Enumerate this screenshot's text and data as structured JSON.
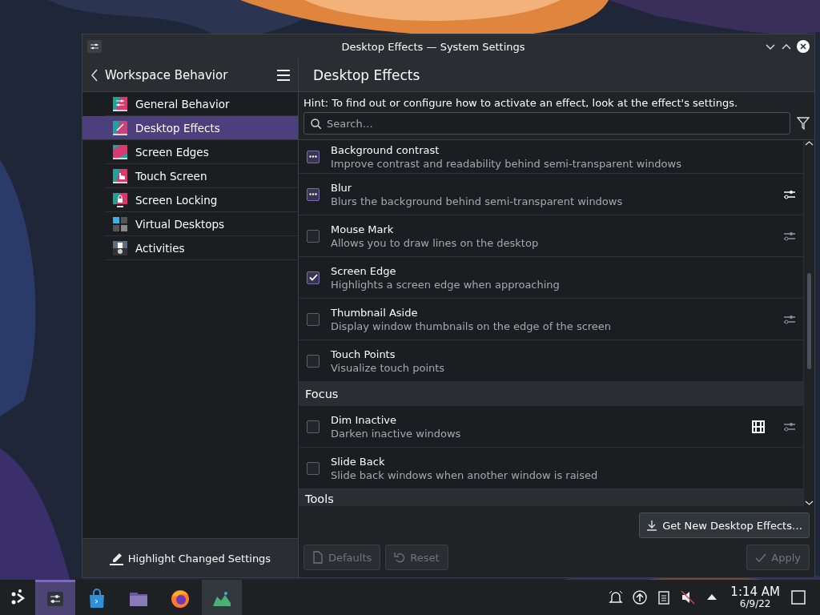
{
  "window": {
    "title": "Desktop Effects — System Settings"
  },
  "sidebar": {
    "title": "Workspace Behavior",
    "items": [
      {
        "label": "General Behavior",
        "selected": false
      },
      {
        "label": "Desktop Effects",
        "selected": true
      },
      {
        "label": "Screen Edges",
        "selected": false
      },
      {
        "label": "Touch Screen",
        "selected": false
      },
      {
        "label": "Screen Locking",
        "selected": false
      },
      {
        "label": "Virtual Desktops",
        "selected": false
      },
      {
        "label": "Activities",
        "selected": false
      }
    ],
    "footer_button": "Highlight Changed Settings"
  },
  "page": {
    "title": "Desktop Effects",
    "hint": "Hint: To find out or configure how to activate an effect, look at the effect's settings.",
    "search": {
      "placeholder": "Search…"
    },
    "sections": [
      {
        "effects": [
          {
            "kind": "exclusive",
            "name": "Background contrast",
            "description": "Improve contrast and readability behind semi-transparent windows",
            "partially_checked": true
          },
          {
            "kind": "exclusive",
            "name": "Blur",
            "description": "Blurs the background behind semi-transparent windows",
            "partially_checked": true,
            "buttons": [
              {
                "kind": "configure",
                "disabled": false
              }
            ]
          },
          {
            "kind": "checkbox",
            "name": "Mouse Mark",
            "description": "Allows you to draw lines on the desktop",
            "checked": false,
            "buttons": [
              {
                "kind": "configure",
                "disabled": true
              }
            ]
          },
          {
            "kind": "checkbox",
            "name": "Screen Edge",
            "description": "Highlights a screen edge when approaching",
            "checked": true
          },
          {
            "kind": "checkbox",
            "name": "Thumbnail Aside",
            "description": "Display window thumbnails on the edge of the screen",
            "checked": false,
            "buttons": [
              {
                "kind": "configure",
                "disabled": true
              }
            ]
          },
          {
            "kind": "checkbox",
            "name": "Touch Points",
            "description": "Visualize touch points",
            "checked": false
          }
        ]
      },
      {
        "title": "Focus",
        "effects": [
          {
            "kind": "checkbox",
            "name": "Dim Inactive",
            "description": "Darken inactive windows",
            "checked": false,
            "buttons": [
              {
                "kind": "video",
                "disabled": false
              },
              {
                "kind": "configure",
                "disabled": true
              }
            ]
          },
          {
            "kind": "checkbox",
            "name": "Slide Back",
            "description": "Slide back windows when another window is raised",
            "checked": false
          }
        ]
      },
      {
        "title": "Tools"
      }
    ],
    "get_new_button": "Get New Desktop Effects…",
    "buttons": [
      {
        "kind": "defaults",
        "label": "Defaults",
        "disabled": true
      },
      {
        "kind": "reset",
        "label": "Reset",
        "disabled": true
      },
      {
        "kind": "apply",
        "label": "Apply",
        "disabled": true
      }
    ]
  },
  "taskbar": {
    "apps": [
      {
        "selected": true,
        "running": true
      },
      {
        "selected": false,
        "running": false
      },
      {
        "selected": false,
        "running": false
      },
      {
        "selected": false,
        "running": false
      },
      {
        "selected": false,
        "running": true
      }
    ],
    "clock": {
      "time": "1:14 AM",
      "date": "6/9/22"
    }
  }
}
